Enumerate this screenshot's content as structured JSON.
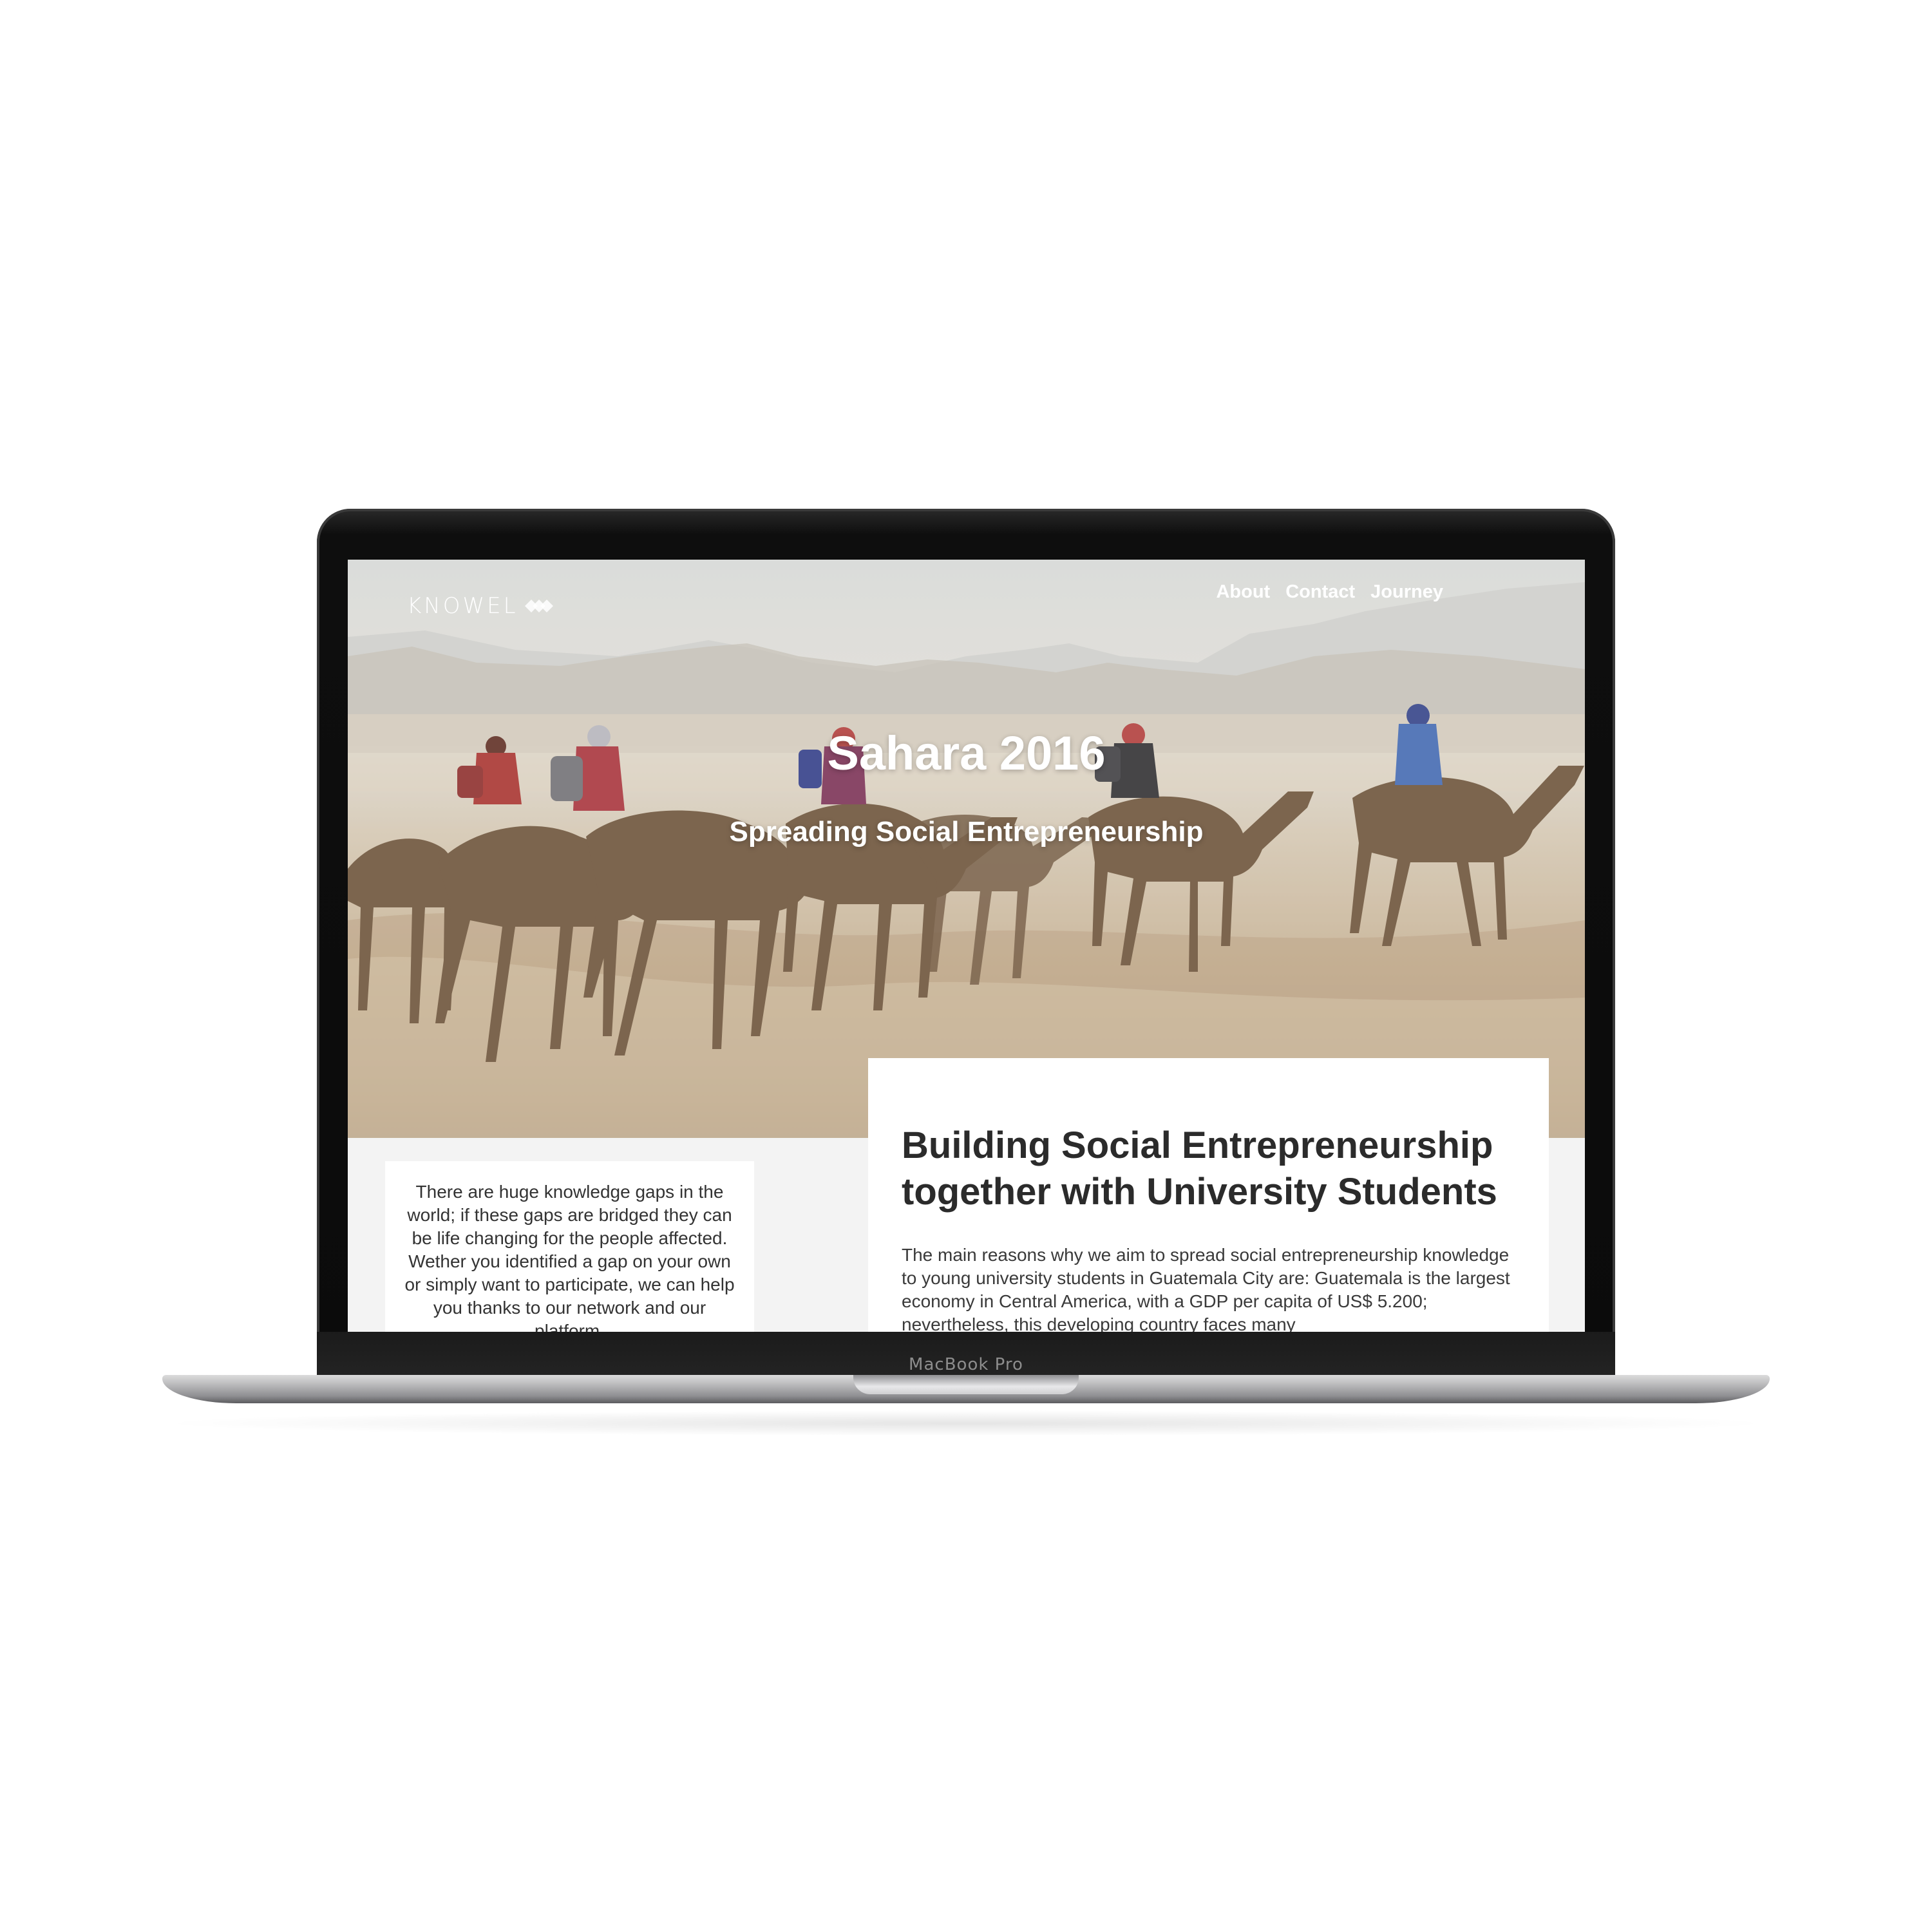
{
  "device": {
    "label": "MacBook Pro"
  },
  "site": {
    "logo_text": "KNOWEL",
    "nav": [
      "About",
      "Contact",
      "Journey"
    ]
  },
  "hero": {
    "title": "Sahara 2016",
    "subtitle": "Spreading Social Entrepreneurship"
  },
  "intro_card": {
    "text": "There are huge knowledge gaps in the world; if these gaps are bridged they can be life changing for the people affected. Wether you identified a gap on your own or simply want to participate, we can help you thanks to our network and our platform."
  },
  "article": {
    "heading": "Building Social Entrepreneurship together with University Students",
    "body": "The main reasons why we aim to spread social entrepreneurship knowledge to young university students in Guatemala City are: Guatemala is the largest economy in Central America, with a GDP per capita of US$ 5.200; nevertheless, this developing country faces many"
  },
  "colors": {
    "page_background": "#f3f3f3",
    "card_background": "#ffffff",
    "heading_text": "#2b2b2b",
    "body_text": "#3a3a3a",
    "nav_text": "#ffffff"
  }
}
